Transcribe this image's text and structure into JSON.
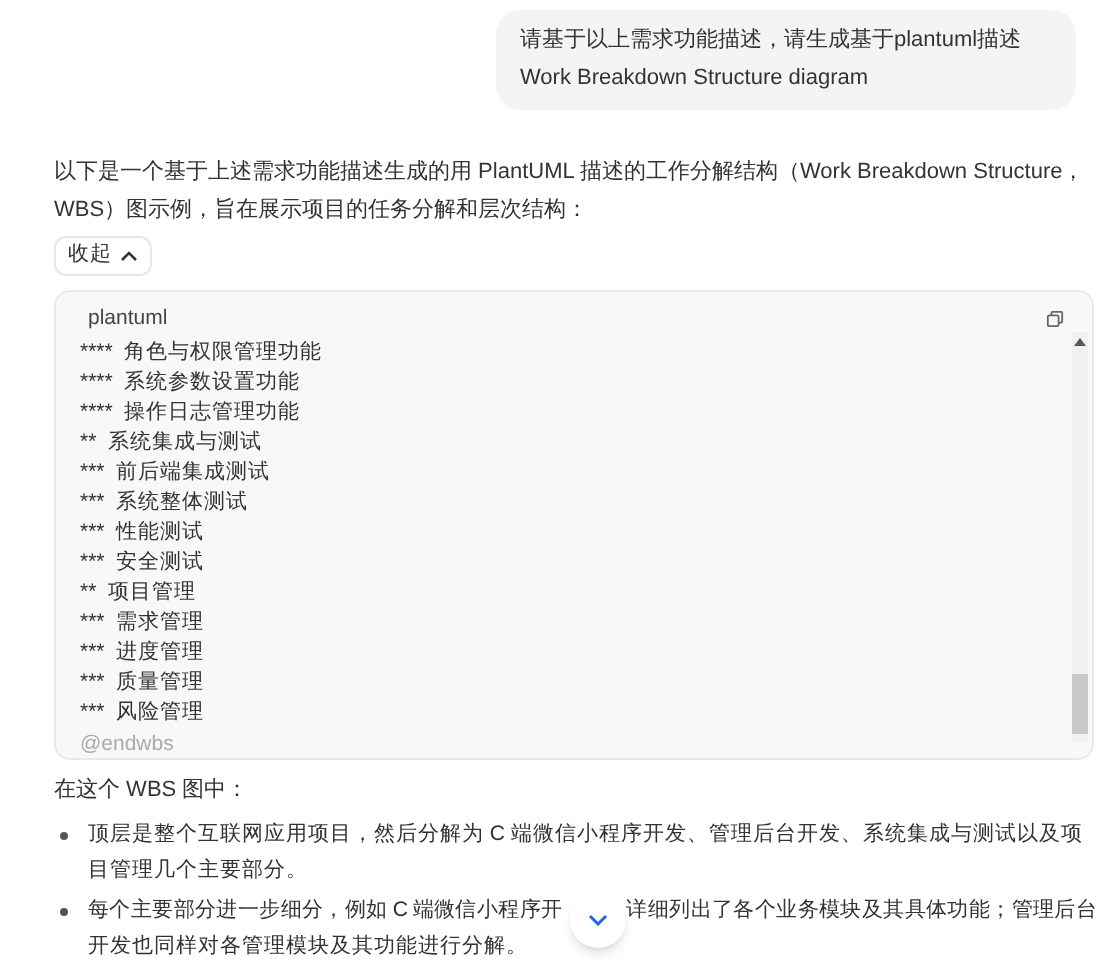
{
  "user_message": "请基于以上需求功能描述，请生成基于plantuml描述 Work Breakdown Structure diagram",
  "intro": "以下是一个基于上述需求功能描述生成的用 PlantUML 描述的工作分解结构（Work Breakdown Structure，WBS）图示例，旨在展示项目的任务分解和层次结构：",
  "collapse_button": {
    "label": "收起",
    "expanded": true
  },
  "code_block": {
    "language": "plantuml",
    "lines": [
      "****  角色与权限管理功能",
      "****  系统参数设置功能",
      "****  操作日志管理功能",
      "**  系统集成与测试",
      "***  前后端集成测试",
      "***  系统整体测试",
      "***  性能测试",
      "***  安全测试",
      "**  项目管理",
      "***  需求管理",
      "***  进度管理",
      "***  质量管理",
      "***  风险管理"
    ],
    "footer": "@endwbs"
  },
  "summary_heading": "在这个 WBS 图中：",
  "bullets": [
    {
      "parts": [
        "顶层是整个互联网应用项目，然后分解为 C 端微信小程序开发、管理后台开发、系统集成与测试以及项目管理几个主要部分。"
      ]
    },
    {
      "parts": [
        "每个主要部分进一步细分，例如 C 端微信小程序开",
        "详细列出了各个业务模块及其具体功能；管理后台",
        "开发也同样对各管理模块及其功能进行分解。"
      ]
    }
  ]
}
